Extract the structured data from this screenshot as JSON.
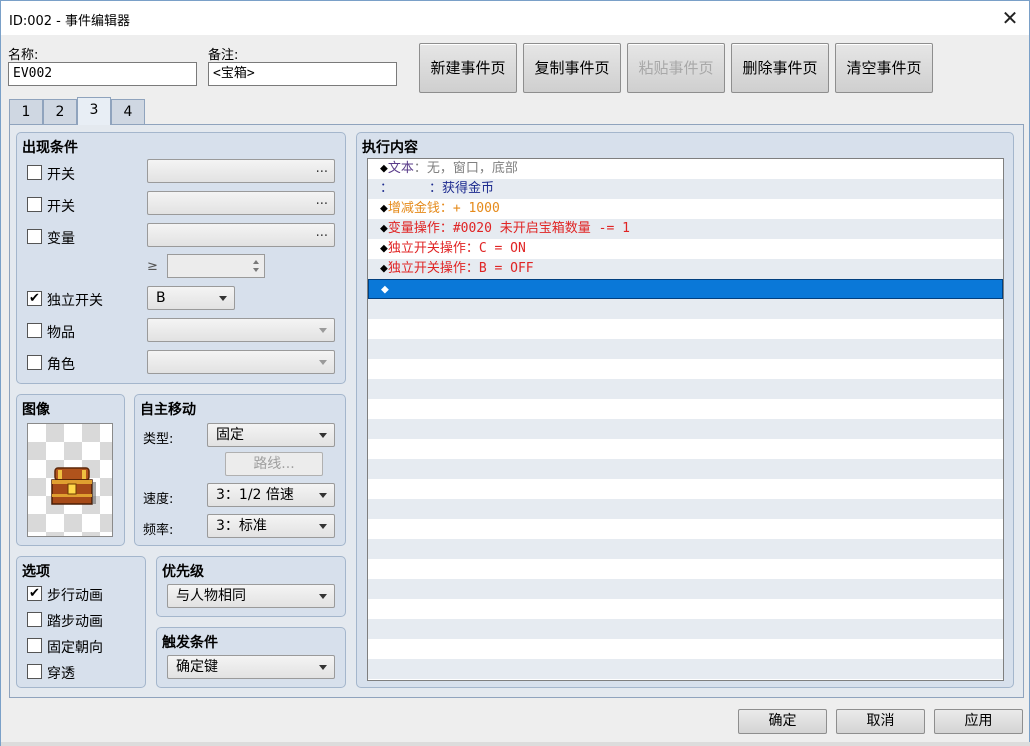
{
  "window": {
    "title": "ID:002 - 事件编辑器",
    "close_glyph": "✕"
  },
  "header": {
    "name_label": "名称:",
    "name_value": "EV002",
    "note_label": "备注:",
    "note_value": "<宝箱>",
    "buttons": {
      "new_page": "新建事件页",
      "copy_page": "复制事件页",
      "paste_page": "粘贴事件页",
      "delete_page": "删除事件页",
      "clear_page": "清空事件页"
    }
  },
  "tabs": [
    "1",
    "2",
    "3",
    "4"
  ],
  "active_tab": "3",
  "conditions": {
    "title": "出现条件",
    "switch1_label": "开关",
    "switch2_label": "开关",
    "variable_label": "变量",
    "gte": "≥",
    "self_switch_label": "独立开关",
    "self_switch_checked": true,
    "self_switch_value": "B",
    "item_label": "物品",
    "actor_label": "角色",
    "dots": "..."
  },
  "image": {
    "title": "图像"
  },
  "autonomous": {
    "title": "自主移动",
    "type_label": "类型:",
    "type_value": "固定",
    "route_button": "路线...",
    "speed_label": "速度:",
    "speed_value": "3：1/2 倍速",
    "freq_label": "频率:",
    "freq_value": "3：标准"
  },
  "options": {
    "title": "选项",
    "walking_anim": "步行动画",
    "walking_checked": true,
    "stepping_anim": "踏步动画",
    "direction_fix": "固定朝向",
    "through": "穿透"
  },
  "priority": {
    "title": "优先级",
    "value": "与人物相同"
  },
  "trigger": {
    "title": "触发条件",
    "value": "确定键"
  },
  "contents": {
    "title": "执行内容",
    "lines": [
      {
        "a": "◆",
        "b": "文本",
        "c": "：无，窗口，底部"
      },
      {
        "a": "：",
        "b": "：获得金币"
      },
      {
        "a": "◆",
        "b": "增减金钱：+ 1000"
      },
      {
        "a": "◆",
        "b": "变量操作：#0020 未开启宝箱数量 -= 1"
      },
      {
        "a": "◆",
        "b": "独立开关操作：C = ON"
      },
      {
        "a": "◆",
        "b": "独立开关操作：B = OFF"
      },
      {
        "a": "◆"
      }
    ]
  },
  "footer": {
    "ok": "确定",
    "cancel": "取消",
    "apply": "应用"
  },
  "colors": {
    "selected_row": "#0a78d8",
    "text_cmd": "#5a3c8a",
    "gold_cmd": "#e58a1a",
    "red_cmd": "#e02424"
  }
}
